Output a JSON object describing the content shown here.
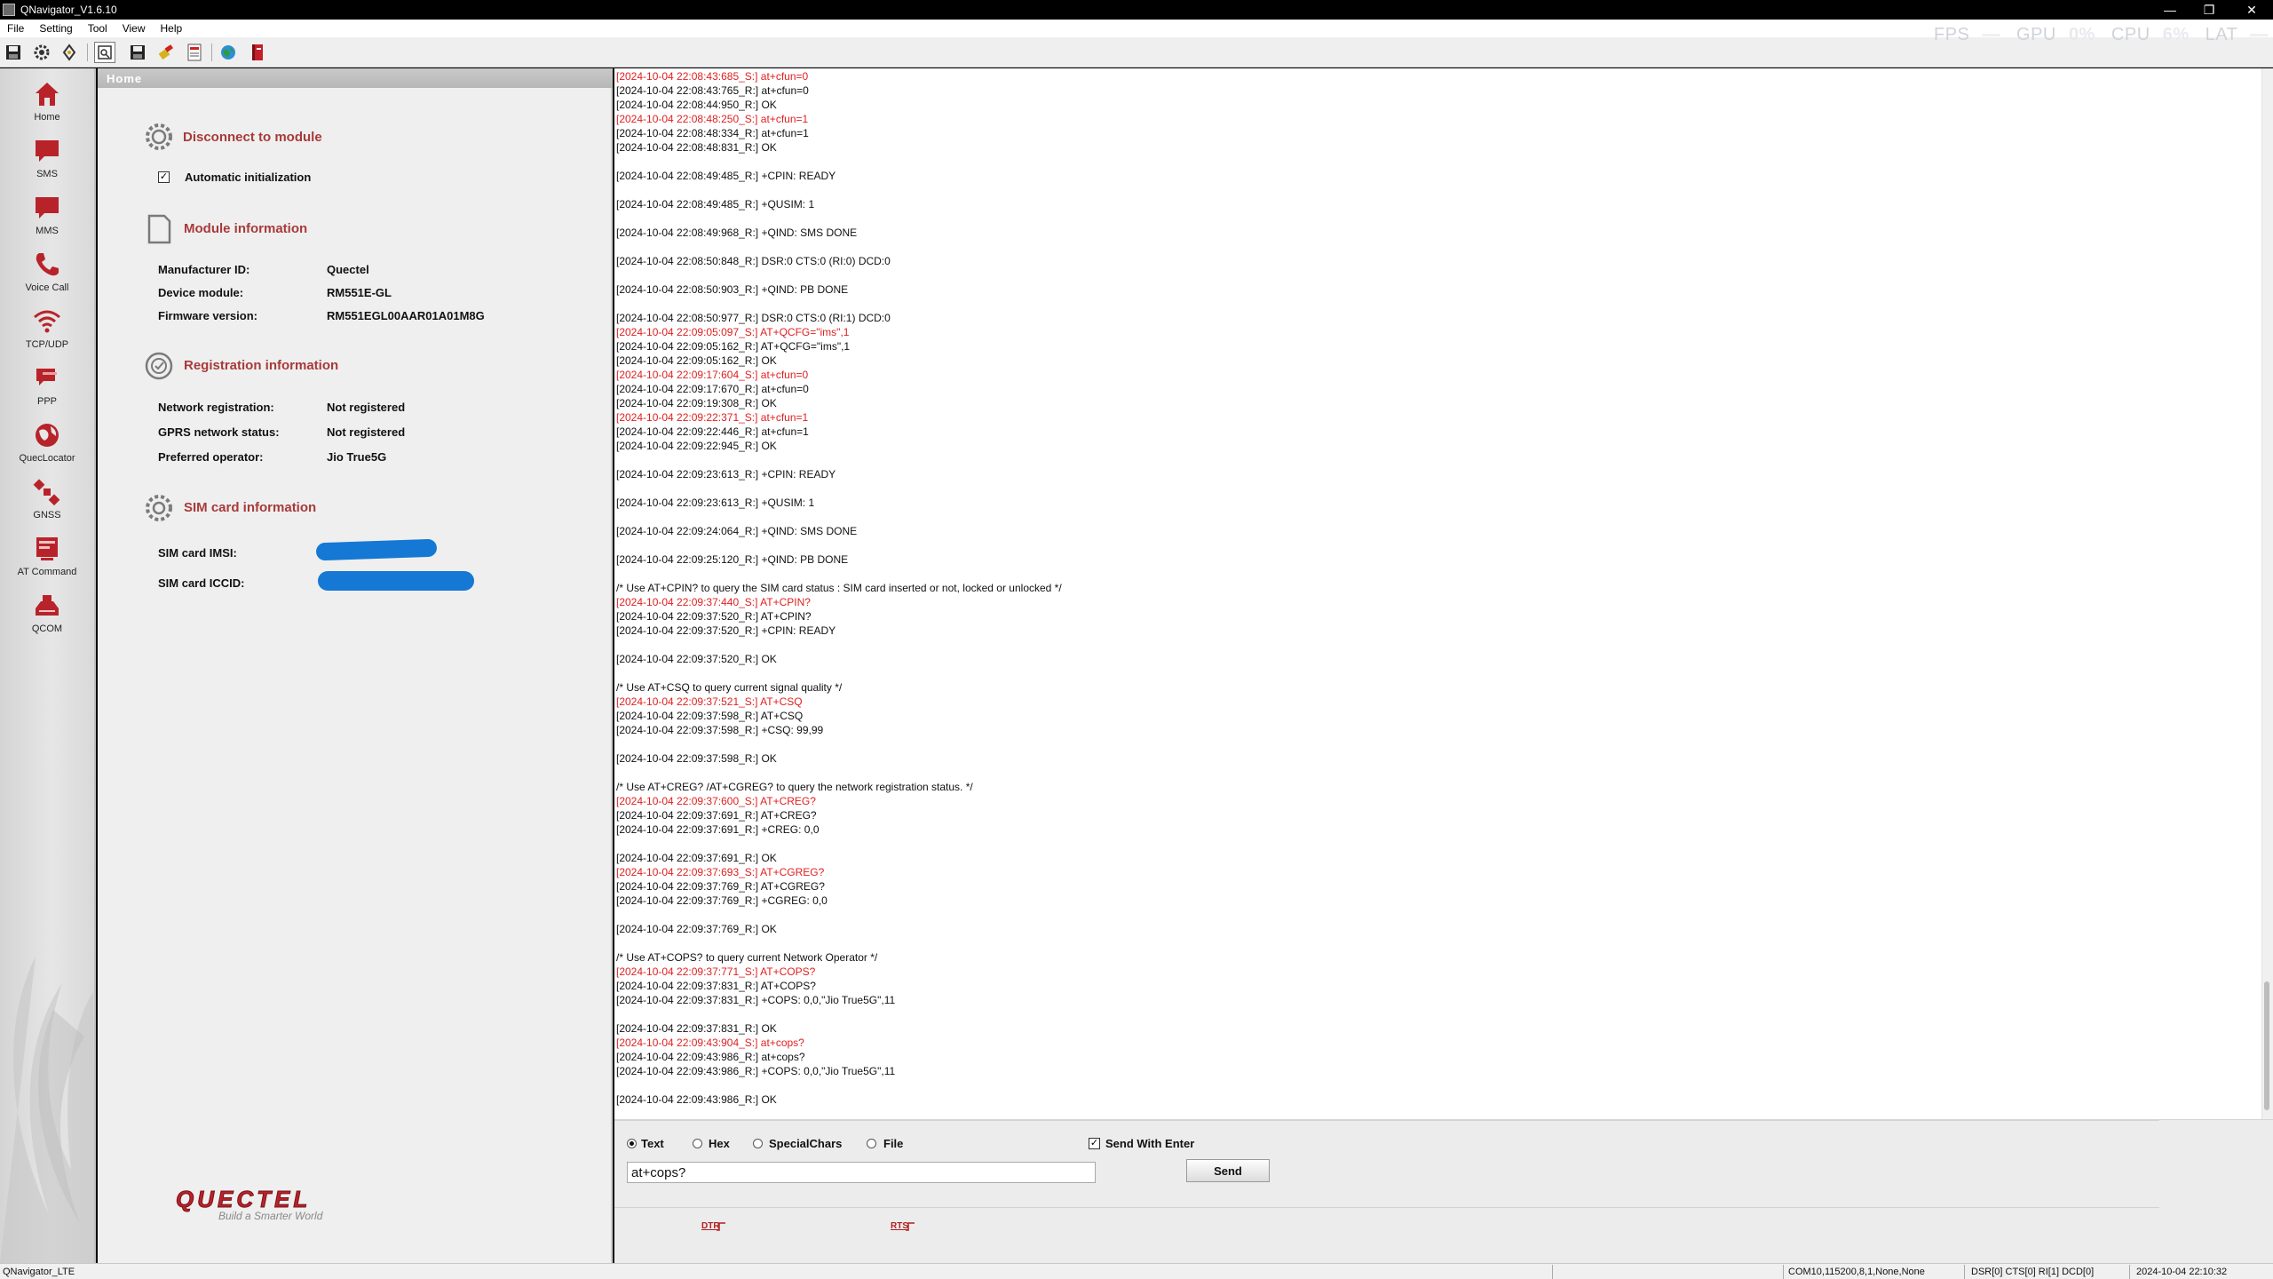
{
  "window": {
    "title": "QNavigator_V1.6.10",
    "controls": {
      "minimize": "—",
      "restore": "❐",
      "close": "✕"
    }
  },
  "menu": [
    "File",
    "Setting",
    "Tool",
    "View",
    "Help"
  ],
  "overlay": {
    "fps_label": "FPS",
    "fps_value": "—",
    "gpu_label": "GPU",
    "gpu_value": "0%",
    "cpu_label": "CPU",
    "cpu_value": "6%",
    "lat_label": "LAT",
    "lat_value": "—"
  },
  "sidebar": {
    "items": [
      {
        "label": "Home",
        "icon": "home-icon"
      },
      {
        "label": "SMS",
        "icon": "sms-icon"
      },
      {
        "label": "MMS",
        "icon": "mms-icon"
      },
      {
        "label": "Voice Call",
        "icon": "phone-icon"
      },
      {
        "label": "TCP/UDP",
        "icon": "wifi-icon"
      },
      {
        "label": "PPP",
        "icon": "chat-icon"
      },
      {
        "label": "QuecLocator",
        "icon": "globe-icon"
      },
      {
        "label": "GNSS",
        "icon": "satellite-icon"
      },
      {
        "label": "AT Command",
        "icon": "at-command-icon"
      },
      {
        "label": "QCOM",
        "icon": "qcom-icon"
      }
    ]
  },
  "home": {
    "tab": "Home",
    "disconnect_label": "Disconnect to module",
    "auto_init_label": "Automatic initialization",
    "auto_init_checked": true,
    "module_info_title": "Module information",
    "manufacturer_label": "Manufacturer ID:",
    "manufacturer_value": "Quectel",
    "device_label": "Device module:",
    "device_value": "RM551E-GL",
    "firmware_label": "Firmware version:",
    "firmware_value": "RM551EGL00AAR01A01M8G",
    "registration_title": "Registration information",
    "network_reg_label": "Network registration:",
    "network_reg_value": "Not registered",
    "gprs_label": "GPRS network status:",
    "gprs_value": "Not registered",
    "operator_label": "Preferred operator:",
    "operator_value": "Jio True5G",
    "sim_title": "SIM card information",
    "imsi_label": "SIM card IMSI:",
    "iccid_label": "SIM card ICCID:",
    "logo_text": "QUECTEL",
    "logo_tagline": "Build a Smarter World"
  },
  "log": [
    {
      "t": "[2024-10-04 22:08:43:685_S:] at+cfun=0",
      "sent": true
    },
    {
      "t": "[2024-10-04 22:08:43:765_R:] at+cfun=0",
      "sent": false
    },
    {
      "t": "[2024-10-04 22:08:44:950_R:] OK",
      "sent": false
    },
    {
      "t": "[2024-10-04 22:08:48:250_S:] at+cfun=1",
      "sent": true
    },
    {
      "t": "[2024-10-04 22:08:48:334_R:] at+cfun=1",
      "sent": false
    },
    {
      "t": "[2024-10-04 22:08:48:831_R:] OK",
      "sent": false
    },
    {
      "t": "",
      "sent": false
    },
    {
      "t": "[2024-10-04 22:08:49:485_R:] +CPIN: READY",
      "sent": false
    },
    {
      "t": "",
      "sent": false
    },
    {
      "t": "[2024-10-04 22:08:49:485_R:] +QUSIM: 1",
      "sent": false
    },
    {
      "t": "",
      "sent": false
    },
    {
      "t": "[2024-10-04 22:08:49:968_R:] +QIND: SMS DONE",
      "sent": false
    },
    {
      "t": "",
      "sent": false
    },
    {
      "t": "[2024-10-04 22:08:50:848_R:] DSR:0 CTS:0 (RI:0) DCD:0",
      "sent": false
    },
    {
      "t": "",
      "sent": false
    },
    {
      "t": "[2024-10-04 22:08:50:903_R:] +QIND: PB DONE",
      "sent": false
    },
    {
      "t": "",
      "sent": false
    },
    {
      "t": "[2024-10-04 22:08:50:977_R:] DSR:0 CTS:0 (RI:1) DCD:0",
      "sent": false
    },
    {
      "t": "[2024-10-04 22:09:05:097_S:] AT+QCFG=\"ims\",1",
      "sent": true
    },
    {
      "t": "[2024-10-04 22:09:05:162_R:] AT+QCFG=\"ims\",1",
      "sent": false
    },
    {
      "t": "[2024-10-04 22:09:05:162_R:] OK",
      "sent": false
    },
    {
      "t": "[2024-10-04 22:09:17:604_S:] at+cfun=0",
      "sent": true
    },
    {
      "t": "[2024-10-04 22:09:17:670_R:] at+cfun=0",
      "sent": false
    },
    {
      "t": "[2024-10-04 22:09:19:308_R:] OK",
      "sent": false
    },
    {
      "t": "[2024-10-04 22:09:22:371_S:] at+cfun=1",
      "sent": true
    },
    {
      "t": "[2024-10-04 22:09:22:446_R:] at+cfun=1",
      "sent": false
    },
    {
      "t": "[2024-10-04 22:09:22:945_R:] OK",
      "sent": false
    },
    {
      "t": "",
      "sent": false
    },
    {
      "t": "[2024-10-04 22:09:23:613_R:] +CPIN: READY",
      "sent": false
    },
    {
      "t": "",
      "sent": false
    },
    {
      "t": "[2024-10-04 22:09:23:613_R:] +QUSIM: 1",
      "sent": false
    },
    {
      "t": "",
      "sent": false
    },
    {
      "t": "[2024-10-04 22:09:24:064_R:] +QIND: SMS DONE",
      "sent": false
    },
    {
      "t": "",
      "sent": false
    },
    {
      "t": "[2024-10-04 22:09:25:120_R:] +QIND: PB DONE",
      "sent": false
    },
    {
      "t": "",
      "sent": false
    },
    {
      "t": "/* Use AT+CPIN? to query the SIM card status : SIM card inserted or not, locked or unlocked */",
      "sent": false
    },
    {
      "t": "[2024-10-04 22:09:37:440_S:] AT+CPIN?",
      "sent": true
    },
    {
      "t": "[2024-10-04 22:09:37:520_R:] AT+CPIN?",
      "sent": false
    },
    {
      "t": "[2024-10-04 22:09:37:520_R:] +CPIN: READY",
      "sent": false
    },
    {
      "t": "",
      "sent": false
    },
    {
      "t": "[2024-10-04 22:09:37:520_R:] OK",
      "sent": false
    },
    {
      "t": "",
      "sent": false
    },
    {
      "t": "/* Use AT+CSQ to query current signal quality */",
      "sent": false
    },
    {
      "t": "[2024-10-04 22:09:37:521_S:] AT+CSQ",
      "sent": true
    },
    {
      "t": "[2024-10-04 22:09:37:598_R:] AT+CSQ",
      "sent": false
    },
    {
      "t": "[2024-10-04 22:09:37:598_R:] +CSQ: 99,99",
      "sent": false
    },
    {
      "t": "",
      "sent": false
    },
    {
      "t": "[2024-10-04 22:09:37:598_R:] OK",
      "sent": false
    },
    {
      "t": "",
      "sent": false
    },
    {
      "t": "/* Use AT+CREG? /AT+CGREG? to query the network registration status. */",
      "sent": false
    },
    {
      "t": "[2024-10-04 22:09:37:600_S:] AT+CREG?",
      "sent": true
    },
    {
      "t": "[2024-10-04 22:09:37:691_R:] AT+CREG?",
      "sent": false
    },
    {
      "t": "[2024-10-04 22:09:37:691_R:] +CREG: 0,0",
      "sent": false
    },
    {
      "t": "",
      "sent": false
    },
    {
      "t": "[2024-10-04 22:09:37:691_R:] OK",
      "sent": false
    },
    {
      "t": "[2024-10-04 22:09:37:693_S:] AT+CGREG?",
      "sent": true
    },
    {
      "t": "[2024-10-04 22:09:37:769_R:] AT+CGREG?",
      "sent": false
    },
    {
      "t": "[2024-10-04 22:09:37:769_R:] +CGREG: 0,0",
      "sent": false
    },
    {
      "t": "",
      "sent": false
    },
    {
      "t": "[2024-10-04 22:09:37:769_R:] OK",
      "sent": false
    },
    {
      "t": "",
      "sent": false
    },
    {
      "t": "/* Use AT+COPS? to query current Network Operator */",
      "sent": false
    },
    {
      "t": "[2024-10-04 22:09:37:771_S:] AT+COPS?",
      "sent": true
    },
    {
      "t": "[2024-10-04 22:09:37:831_R:] AT+COPS?",
      "sent": false
    },
    {
      "t": "[2024-10-04 22:09:37:831_R:] +COPS: 0,0,\"Jio True5G\",11",
      "sent": false
    },
    {
      "t": "",
      "sent": false
    },
    {
      "t": "[2024-10-04 22:09:37:831_R:] OK",
      "sent": false
    },
    {
      "t": "[2024-10-04 22:09:43:904_S:] at+cops?",
      "sent": true
    },
    {
      "t": "[2024-10-04 22:09:43:986_R:] at+cops?",
      "sent": false
    },
    {
      "t": "[2024-10-04 22:09:43:986_R:] +COPS: 0,0,\"Jio True5G\",11",
      "sent": false
    },
    {
      "t": "",
      "sent": false
    },
    {
      "t": "[2024-10-04 22:09:43:986_R:] OK",
      "sent": false
    }
  ],
  "send": {
    "mode_text": "Text",
    "mode_hex": "Hex",
    "mode_special": "SpecialChars",
    "mode_file": "File",
    "selected_mode": "Text",
    "send_with_enter_label": "Send With Enter",
    "send_with_enter_checked": true,
    "input_value": "at+cops?",
    "send_label": "Send",
    "dtr_label": "DTR",
    "rts_label": "RTS"
  },
  "status": {
    "app": "QNavigator_LTE",
    "port": "COM10,115200,8,1,None,None",
    "signals": "DSR[0] CTS[0] RI[1] DCD[0]",
    "time": "2024-10-04 22:10:32"
  },
  "colors": {
    "sent": "#e02020",
    "received": "#111111",
    "section_head": "#a83a3a",
    "nav_icon": "#b8232a",
    "redaction": "#1478d4"
  }
}
